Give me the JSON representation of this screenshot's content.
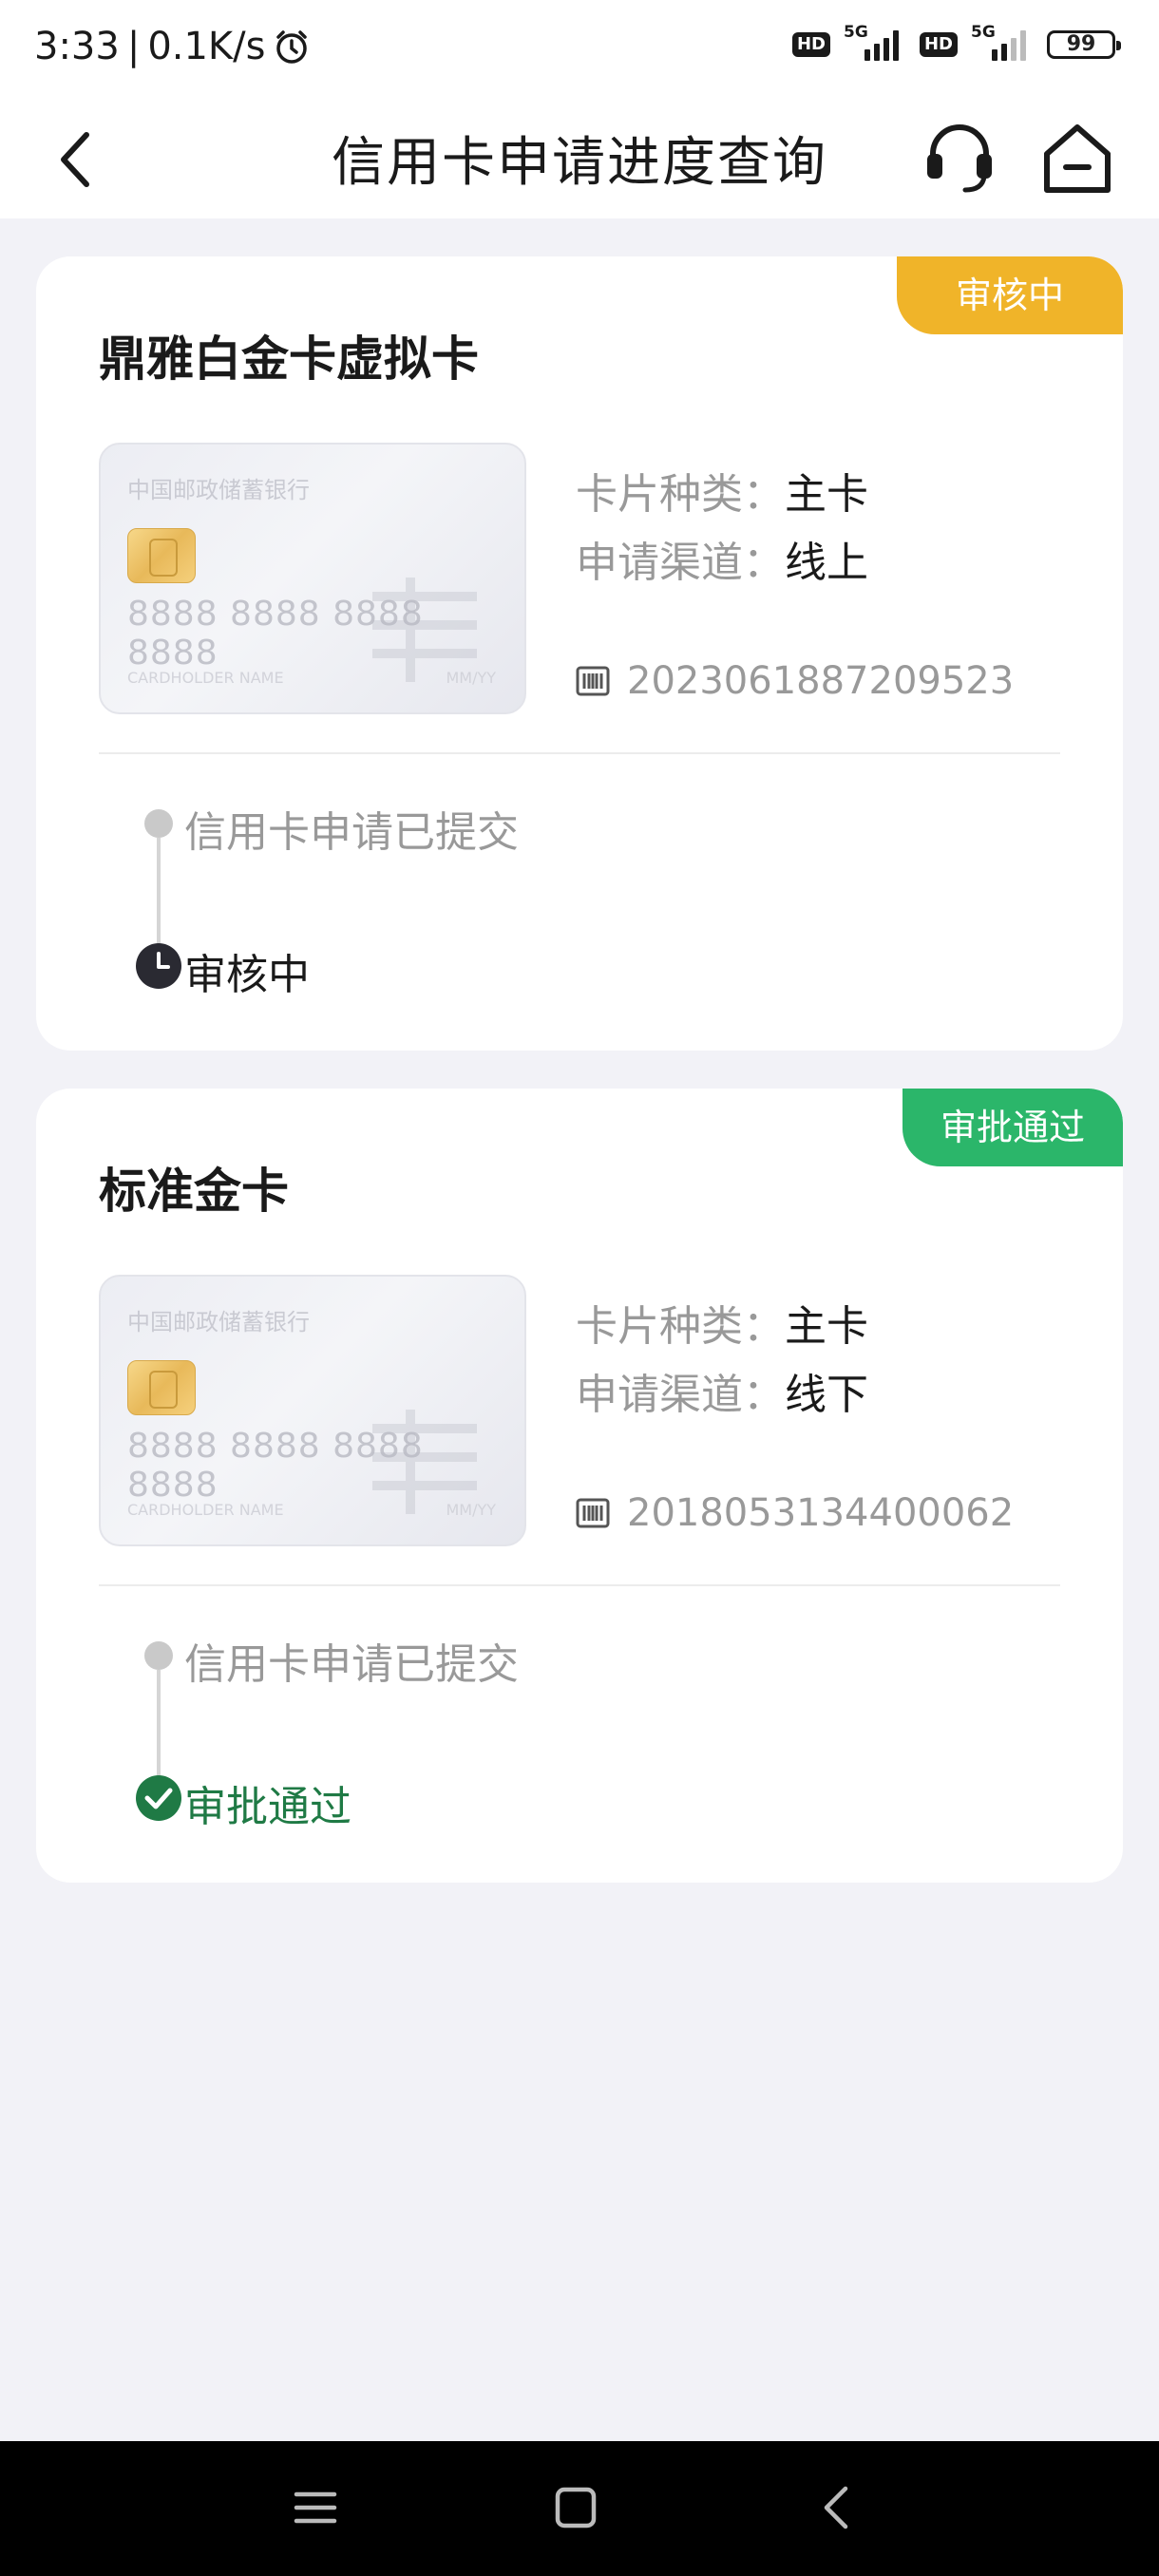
{
  "status_bar": {
    "time": "3:33",
    "separator": "|",
    "speed": "0.1K/s",
    "hd1": "HD",
    "net1": "5G",
    "hd2": "HD",
    "net2": "5G",
    "battery": "99"
  },
  "nav": {
    "title": "信用卡申请进度查询"
  },
  "applications": [
    {
      "status": "审核中",
      "status_color": "#f0b429",
      "card_name": "鼎雅白金卡虚拟卡",
      "bank_name": "中国邮政储蓄银行",
      "card_number": "8888 8888 8888 8888",
      "holder": "CARDHOLDER NAME",
      "exp": "MM/YY",
      "type_label": "卡片种类：",
      "type_value": "主卡",
      "channel_label": "申请渠道：",
      "channel_value": "线上",
      "application_no": "2023061887209523",
      "timeline": [
        {
          "text": "信用卡申请已提交"
        },
        {
          "text": "审核中"
        }
      ]
    },
    {
      "status": "审批通过",
      "status_color": "#2bb66a",
      "card_name": "标准金卡",
      "bank_name": "中国邮政储蓄银行",
      "card_number": "8888 8888 8888 8888",
      "holder": "CARDHOLDER NAME",
      "exp": "MM/YY",
      "type_label": "卡片种类：",
      "type_value": "主卡",
      "channel_label": "申请渠道：",
      "channel_value": "线下",
      "application_no": "2018053134400062",
      "timeline": [
        {
          "text": "信用卡申请已提交"
        },
        {
          "text": "审批通过"
        }
      ]
    }
  ],
  "icons": {
    "back": "chevron-left-icon",
    "service": "headset-icon",
    "home": "home-icon",
    "barcode": "barcode-icon",
    "pending": "clock-icon",
    "approved": "check-circle-icon"
  }
}
